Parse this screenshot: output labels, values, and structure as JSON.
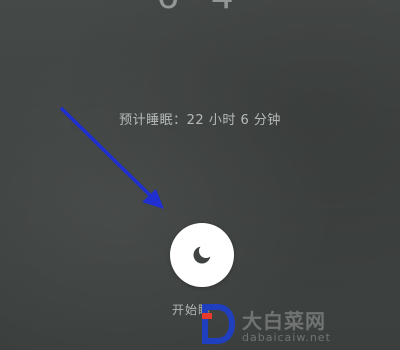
{
  "clock": {
    "partial_time": "6 4"
  },
  "sleep": {
    "estimate_text": "预计睡眠：22 小时 6 分钟",
    "start_label": "开始睡"
  },
  "annotation": {
    "arrow_color": "#1f2fd0"
  },
  "watermark": {
    "name": "大白菜网",
    "domain": "dabaicaiw.net",
    "brand_color": "#1f3fbf",
    "accent_color": "#e83a2a"
  },
  "icons": {
    "sleep_button_icon": "moon-icon"
  }
}
